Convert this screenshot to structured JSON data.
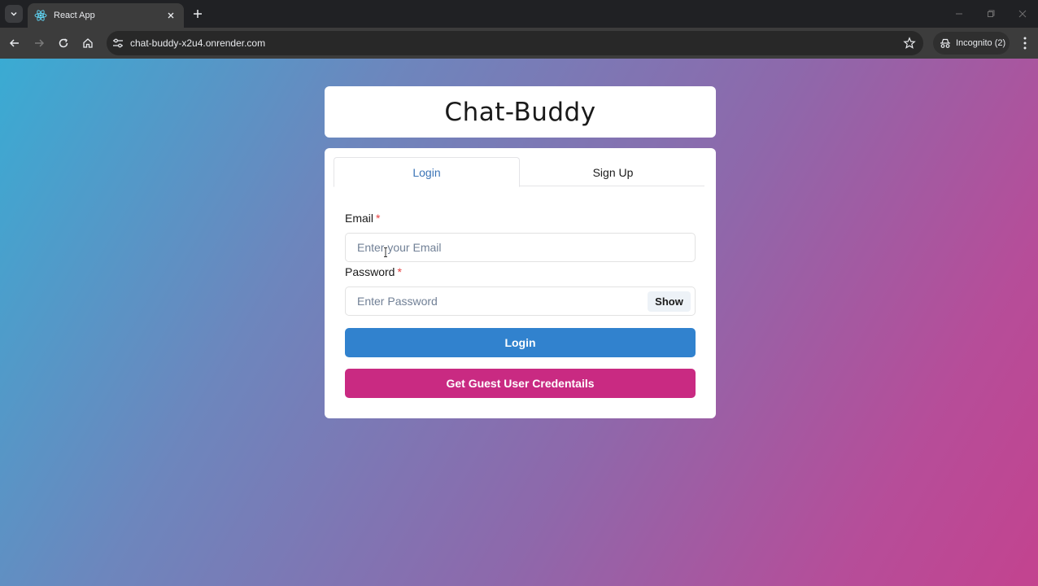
{
  "browser": {
    "tab_title": "React App",
    "url": "chat-buddy-x2u4.onrender.com",
    "incognito_label": "Incognito (2)"
  },
  "app": {
    "brand_title": "Chat-Buddy",
    "tabs": [
      {
        "label": "Login",
        "selected": true
      },
      {
        "label": "Sign Up",
        "selected": false
      }
    ],
    "email": {
      "label": "Email",
      "required_mark": "*",
      "placeholder": "Enter your Email",
      "value": ""
    },
    "password": {
      "label": "Password",
      "required_mark": "*",
      "placeholder": "Enter Password",
      "value": "",
      "toggle_label": "Show"
    },
    "login_button": "Login",
    "guest_button": "Get Guest User Credentails"
  },
  "colors": {
    "login_button": "#3182ce",
    "guest_button": "#c92a82",
    "tab_selected": "#3b74b6",
    "required": "#e53e3e"
  },
  "icons": {
    "tab_menu": "chevron-down-icon",
    "favicon": "react-logo-icon",
    "tab_close": "close-icon",
    "new_tab": "plus-icon",
    "back": "arrow-left-icon",
    "forward": "arrow-right-icon",
    "reload": "reload-icon",
    "home": "home-icon",
    "site_info": "tune-icon",
    "bookmark": "star-icon",
    "incognito": "incognito-icon",
    "menu": "kebab-menu-icon"
  }
}
